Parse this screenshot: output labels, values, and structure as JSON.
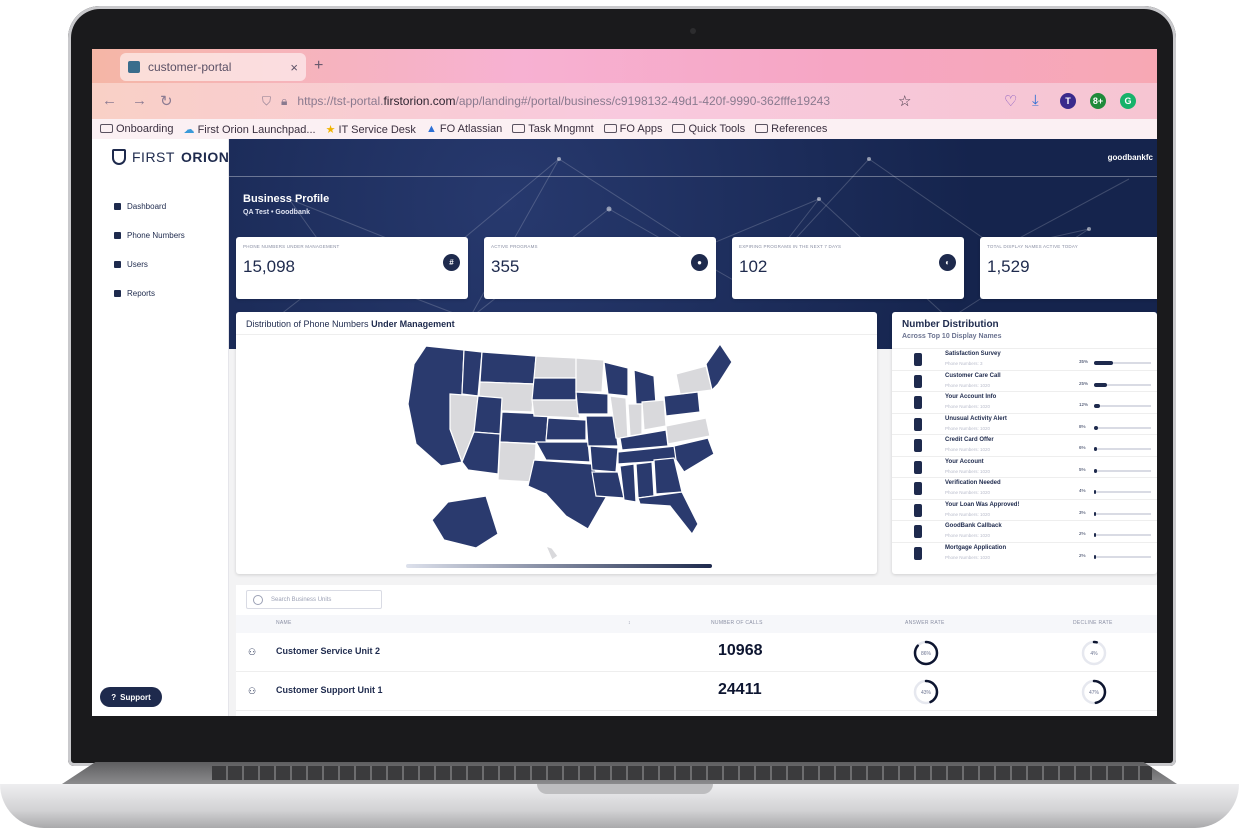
{
  "browser": {
    "tab_title": "customer-portal",
    "tab_close": "×",
    "new_tab": "+",
    "back": "←",
    "forward": "→",
    "reload": "↻",
    "url_prefix": "https://tst-portal.",
    "url_domain": "firstorion.com",
    "url_path": "/app/landing#/portal/business/c9198132-49d1-420f-9990-362fffe19243",
    "bookmarks": [
      "Onboarding",
      "First Orion Launchpad...",
      "IT Service Desk",
      "FO Atlassian",
      "Task Mngmnt",
      "FO Apps",
      "Quick Tools",
      "References"
    ],
    "extensions": [
      {
        "label": "T",
        "color": "#3a2a8c"
      },
      {
        "label": "8+",
        "color": "#1f8a3a"
      },
      {
        "label": "G",
        "color": "#17b26a"
      }
    ]
  },
  "sidebar": {
    "logo_light": "FIRST",
    "logo_bold": "ORION",
    "items": [
      {
        "label": "Dashboard"
      },
      {
        "label": "Phone Numbers"
      },
      {
        "label": "Users"
      },
      {
        "label": "Reports"
      }
    ],
    "support": "Support"
  },
  "header": {
    "user": "goodbankfc",
    "title": "Business Profile",
    "subtitle": "QA Test • Goodbank"
  },
  "kpis": [
    {
      "label": "PHONE NUMBERS UNDER MANAGEMENT",
      "value": "15,098",
      "icon": "#"
    },
    {
      "label": "ACTIVE PROGRAMS",
      "value": "355",
      "icon": "●"
    },
    {
      "label": "EXPIRING PROGRAMS IN THE NEXT 7 DAYS",
      "value": "102",
      "icon": "◐"
    },
    {
      "label": "TOTAL DISPLAY NAMES ACTIVE TODAY",
      "value": "1,529",
      "icon": ""
    }
  ],
  "map": {
    "title_plain": "Distribution of Phone Numbers",
    "title_bold": "Under Management",
    "active_color": "#2a3a6e",
    "inactive_color": "#d9d9dc"
  },
  "distribution": {
    "title": "Number Distribution",
    "subtitle": "Across Top 10 Display Names",
    "items": [
      {
        "name": "Satisfaction Survey",
        "sub": "Phone Numbers: 3",
        "pct_label": "35%",
        "pct": 35
      },
      {
        "name": "Customer Care Call",
        "sub": "Phone Numbers: 1020",
        "pct_label": "25%",
        "pct": 25
      },
      {
        "name": "Your Account Info",
        "sub": "Phone Numbers: 1020",
        "pct_label": "12%",
        "pct": 12
      },
      {
        "name": "Unusual Activity Alert",
        "sub": "Phone Numbers: 1020",
        "pct_label": "8%",
        "pct": 8
      },
      {
        "name": "Credit Card Offer",
        "sub": "Phone Numbers: 1020",
        "pct_label": "6%",
        "pct": 6
      },
      {
        "name": "Your Account",
        "sub": "Phone Numbers: 1020",
        "pct_label": "5%",
        "pct": 5
      },
      {
        "name": "Verification Needed",
        "sub": "Phone Numbers: 1020",
        "pct_label": "4%",
        "pct": 4
      },
      {
        "name": "Your Loan Was Approved!",
        "sub": "Phone Numbers: 1020",
        "pct_label": "3%",
        "pct": 3
      },
      {
        "name": "GoodBank Callback",
        "sub": "Phone Numbers: 1020",
        "pct_label": "2%",
        "pct": 2
      },
      {
        "name": "Mortgage Application",
        "sub": "Phone Numbers: 1020",
        "pct_label": "2%",
        "pct": 2
      }
    ]
  },
  "business_units": {
    "search_placeholder": "Search Business Units",
    "columns": [
      "NAME",
      "NUMBER OF CALLS",
      "ANSWER RATE",
      "DECLINE RATE"
    ],
    "sort_icon": "↕",
    "rows": [
      {
        "name": "Customer Service Unit 2",
        "calls": "10968",
        "answer": 86,
        "answer_label": "86%",
        "decline": 4,
        "decline_label": "4%"
      },
      {
        "name": "Customer Support Unit 1",
        "calls": "24411",
        "answer": 43,
        "answer_label": "43%",
        "decline": 47,
        "decline_label": "47%"
      }
    ]
  }
}
